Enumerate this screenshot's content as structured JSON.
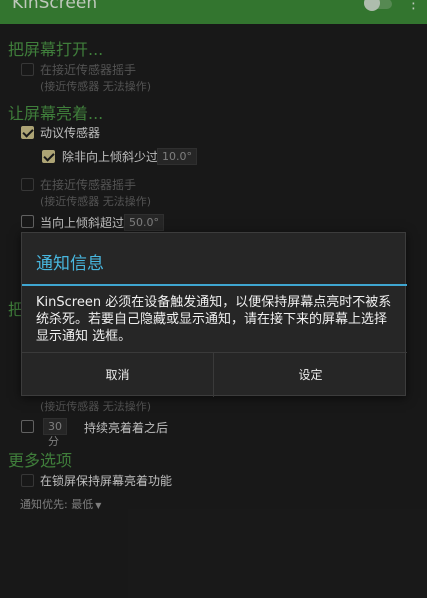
{
  "appbar": {
    "title": "KinScreen",
    "toggle_on": false,
    "menu_icon": "more-vert-icon"
  },
  "sections": {
    "s1": "把屏幕打开...",
    "s2": "让屏幕亮着...",
    "s3": "把",
    "s4": "更多选项"
  },
  "items": {
    "proximity_wave_on": {
      "label": "在接近传感器摇手",
      "note": "(接近传感器 无法操作)"
    },
    "motion_sensor": {
      "label": "动议传感器"
    },
    "tilt_below": {
      "label": "除非向上倾斜少过",
      "value": "10.0°"
    },
    "proximity_wave_keep": {
      "label": "在接近传感器摇手",
      "note": "(接近传感器 无法操作)"
    },
    "tilt_above": {
      "label": "当向上倾斜超过",
      "value": "50.0°"
    },
    "proximity_note_off": {
      "note": "(接近传感器 无法操作)"
    },
    "duration": {
      "value": "30 分",
      "label": "持续亮着着之后"
    },
    "lockscreen_keep": {
      "label": "在锁屏保持屏幕亮着功能"
    },
    "notif_priority": {
      "label": "通知优先: 最低",
      "dropdown_icon": "caret-down-icon"
    }
  },
  "dialog": {
    "title": "通知信息",
    "message": "KinScreen 必须在设备触发通知，以便保持屏幕点亮时不被系统杀死。若要自己隐藏或显示通知，请在接下来的屏幕上选择 显示通知 选框。",
    "cancel": "取消",
    "settings": "设定"
  }
}
